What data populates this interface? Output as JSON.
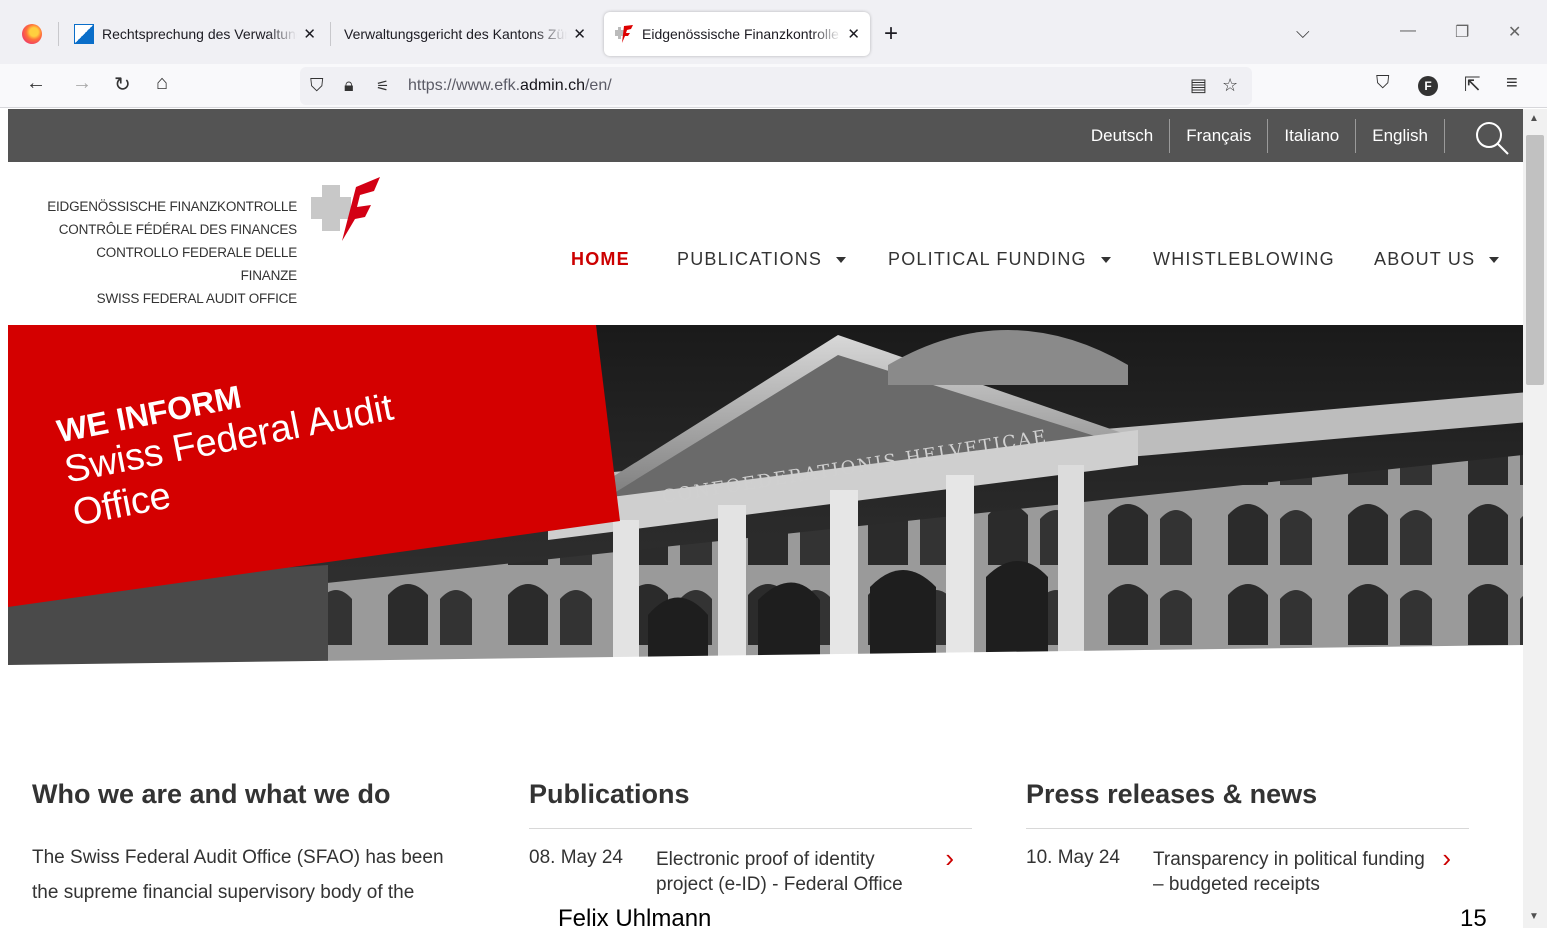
{
  "browser": {
    "tabs": [
      {
        "title": "Rechtsprechung des Verwaltungsgerichts"
      },
      {
        "title": "Verwaltungsgericht des Kantons Zürich"
      },
      {
        "title": "Eidgenössische Finanzkontrolle"
      }
    ],
    "url_prefix": "https://www.efk.",
    "url_domain": "admin.ch",
    "url_suffix": "/en/"
  },
  "site": {
    "languages": [
      "Deutsch",
      "Français",
      "Italiano",
      "English"
    ],
    "logo_lines": [
      "EIDGENÖSSISCHE FINANZKONTROLLE",
      "CONTRÔLE FÉDÉRAL DES FINANCES",
      "CONTROLLO FEDERALE DELLE FINANZE",
      "SWISS FEDERAL AUDIT OFFICE"
    ],
    "nav": {
      "home": "HOME",
      "publications": "PUBLICATIONS",
      "political_funding": "POLITICAL FUNDING",
      "whistleblowing": "WHISTLEBLOWING",
      "about": "ABOUT US"
    },
    "hero": {
      "kicker": "WE INFORM",
      "line1": "Swiss Federal Audit",
      "line2": "Office",
      "building_inscription": "CONFOEDERATIONIS HELVETICAE"
    },
    "who": {
      "heading": "Who we are and what we do",
      "text_line1": "The Swiss Federal Audit Office (SFAO) has been",
      "text_line2": "the supreme financial supervisory body of the"
    },
    "publications": {
      "heading": "Publications",
      "items": [
        {
          "date": "08. May 24",
          "title": "Electronic proof of identity project (e-ID) - Federal Office"
        }
      ]
    },
    "press": {
      "heading": "Press releases & news",
      "items": [
        {
          "date": "10. May 24",
          "title": "Transparency in political funding – budgeted receipts"
        }
      ]
    }
  },
  "overlay": {
    "presenter": "Felix Uhlmann",
    "page_number": "15"
  },
  "colors": {
    "brand_red": "#cc0000",
    "topstrip": "#545454"
  }
}
